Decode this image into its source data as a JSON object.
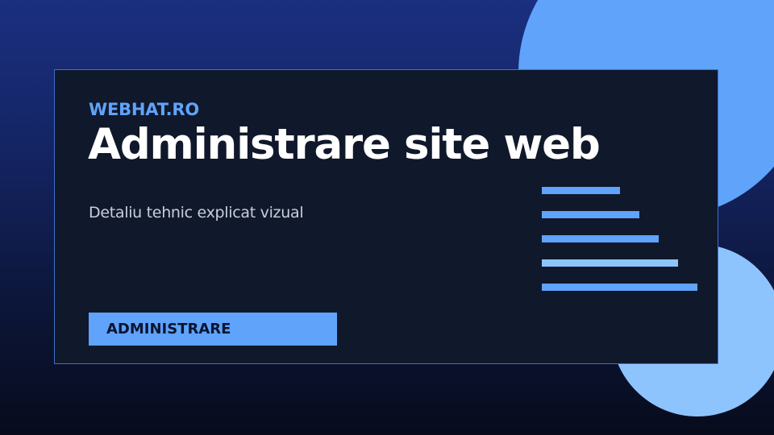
{
  "brand": "WEBHAT.RO",
  "title": "Administrare site web",
  "subtitle": "Detaliu tehnic explicat vizual",
  "tag": "ADMINISTRARE",
  "colors": {
    "accent": "#5fa3fb",
    "accent_light": "#8ec4fd",
    "card": "#10182b",
    "background_top": "#1a2f80",
    "background_bottom": "#070b1c"
  },
  "decoration": {
    "bar_count": 5
  }
}
